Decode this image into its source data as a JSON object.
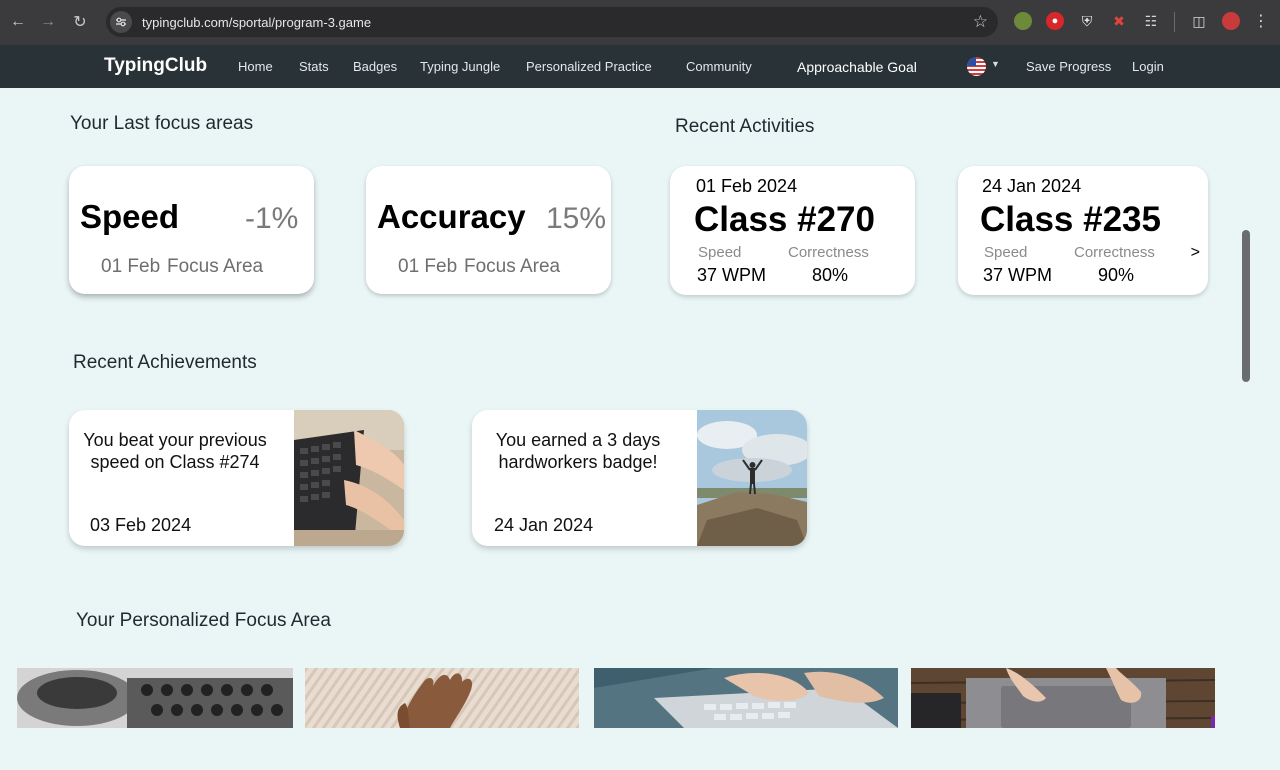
{
  "browser": {
    "url": "typingclub.com/sportal/program-3.game"
  },
  "nav": {
    "logo": "TypingClub",
    "links": [
      "Home",
      "Stats",
      "Badges",
      "Typing Jungle",
      "Personalized Practice",
      "Community"
    ],
    "goal": "Approachable Goal",
    "save": "Save Progress",
    "login": "Login"
  },
  "focus": {
    "title": "Your Last focus areas",
    "cards": [
      {
        "name": "Speed",
        "value": "-1%",
        "date": "01 Feb",
        "label": "Focus Area"
      },
      {
        "name": "Accuracy",
        "value": "15%",
        "date": "01 Feb",
        "label": "Focus Area"
      }
    ]
  },
  "activities": {
    "title": "Recent Activities",
    "cards": [
      {
        "date": "01 Feb 2024",
        "class": "Class #270",
        "speed_label": "Speed",
        "correct_label": "Correctness",
        "speed": "37 WPM",
        "correct": "80%"
      },
      {
        "date": "24 Jan 2024",
        "class": "Class #235",
        "speed_label": "Speed",
        "correct_label": "Correctness",
        "speed": "37 WPM",
        "correct": "90%"
      }
    ],
    "next": ">"
  },
  "achievements": {
    "title": "Recent Achievements",
    "cards": [
      {
        "text": "You beat your previous speed on Class #274",
        "date": "03 Feb 2024"
      },
      {
        "text": "You earned a 3 days hardworkers badge!",
        "date": "24 Jan 2024"
      }
    ]
  },
  "personalized": {
    "title": "Your Personalized Focus Area"
  }
}
